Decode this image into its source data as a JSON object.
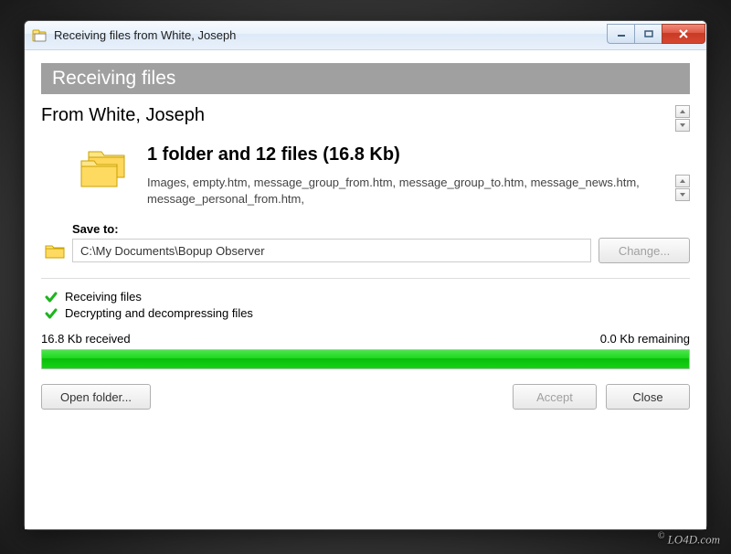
{
  "titlebar": {
    "title": "Receiving files from White, Joseph"
  },
  "banner": "Receiving files",
  "from": "From White, Joseph",
  "summary": {
    "title": "1 folder and 12 files (16.8 Kb)",
    "files": "Images, empty.htm, message_group_from.htm, message_group_to.htm, message_news.htm, message_personal_from.htm,"
  },
  "save": {
    "label": "Save to:",
    "path": "C:\\My Documents\\Bopup Observer",
    "change": "Change..."
  },
  "status": {
    "line1": "Receiving files",
    "line2": "Decrypting and decompressing files"
  },
  "progress": {
    "received": "16.8 Kb received",
    "remaining": "0.0 Kb remaining",
    "percent": 100
  },
  "buttons": {
    "open_folder": "Open folder...",
    "accept": "Accept",
    "close": "Close"
  },
  "watermark": "LO4D.com"
}
